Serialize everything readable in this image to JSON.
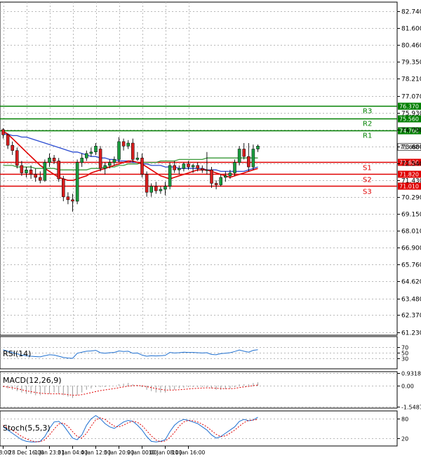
{
  "chart_data": [
    {
      "type": "candlestick",
      "title": "",
      "xlabel": "",
      "ylabel": "",
      "ylim": [
        61.02,
        83.35
      ],
      "grid": true,
      "yticks": [
        "82.740",
        "81.600",
        "80.460",
        "79.350",
        "78.210",
        "77.070",
        "75.930",
        "74.790",
        "73.680",
        "72.540",
        "71.430",
        "70.290",
        "69.150",
        "68.010",
        "66.900",
        "65.760",
        "64.620",
        "63.480",
        "62.370",
        "61.230"
      ],
      "xticks": [
        "08:00",
        "28 Dec 16:00",
        "1 Jan 23:01",
        "3 Jan 04:00",
        "4 Jan 12:00",
        "5 Jan 20:00",
        "9 Jan 00:00",
        "10 Jan 08:00",
        "11 Jan 16:00"
      ],
      "xtick_positions": [
        0,
        5,
        10,
        15,
        20,
        25,
        30,
        35,
        40
      ],
      "levels": [
        {
          "name": "R3",
          "value": 76.37,
          "label": "76.370",
          "color": "#008000"
        },
        {
          "name": "R2",
          "value": 75.56,
          "label": "75.560",
          "color": "#008000"
        },
        {
          "name": "R1",
          "value": 74.76,
          "label": "74.760",
          "color": "#008000"
        },
        {
          "name": "S1",
          "value": 72.62,
          "label": "72.620",
          "color": "#e00000"
        },
        {
          "name": "S2",
          "value": 71.82,
          "label": "71.820",
          "color": "#e00000"
        },
        {
          "name": "S3",
          "value": 71.01,
          "label": "71.010",
          "color": "#e00000"
        }
      ],
      "last_price": {
        "value": 73.68,
        "label": "73.680"
      },
      "candles": [
        [
          74.8,
          74.9,
          74.2,
          74.45
        ],
        [
          74.45,
          74.55,
          73.5,
          73.75
        ],
        [
          73.75,
          74.0,
          73.1,
          73.4
        ],
        [
          73.4,
          73.6,
          72.2,
          72.4
        ],
        [
          72.4,
          72.7,
          71.7,
          71.9
        ],
        [
          71.9,
          72.3,
          71.6,
          72.1
        ],
        [
          72.1,
          72.4,
          71.5,
          71.8
        ],
        [
          71.8,
          72.2,
          71.3,
          71.6
        ],
        [
          71.6,
          72.0,
          71.2,
          71.4
        ],
        [
          71.4,
          72.8,
          71.3,
          72.6
        ],
        [
          72.6,
          73.2,
          72.3,
          72.9
        ],
        [
          72.9,
          73.1,
          72.5,
          72.7
        ],
        [
          72.7,
          72.9,
          71.3,
          71.5
        ],
        [
          71.5,
          71.7,
          70.0,
          70.3
        ],
        [
          70.3,
          70.6,
          69.8,
          70.1
        ],
        [
          70.1,
          70.5,
          69.3,
          70.0
        ],
        [
          70.0,
          72.8,
          69.8,
          72.6
        ],
        [
          72.6,
          73.2,
          72.3,
          72.9
        ],
        [
          72.9,
          73.4,
          72.7,
          73.2
        ],
        [
          73.2,
          73.6,
          73.0,
          73.3
        ],
        [
          73.3,
          73.9,
          73.1,
          73.7
        ],
        [
          73.5,
          73.7,
          72.0,
          72.2
        ],
        [
          72.2,
          72.6,
          71.8,
          72.4
        ],
        [
          72.4,
          72.8,
          72.2,
          72.6
        ],
        [
          72.6,
          73.0,
          72.4,
          72.8
        ],
        [
          72.8,
          74.3,
          72.6,
          74.0
        ],
        [
          74.0,
          74.2,
          73.4,
          73.7
        ],
        [
          73.7,
          74.1,
          73.5,
          73.9
        ],
        [
          73.9,
          74.2,
          72.6,
          72.8
        ],
        [
          72.8,
          73.3,
          72.7,
          72.9
        ],
        [
          72.9,
          73.2,
          71.6,
          71.8
        ],
        [
          71.8,
          72.0,
          70.3,
          70.6
        ],
        [
          70.6,
          71.2,
          70.3,
          71.0
        ],
        [
          71.0,
          71.3,
          70.5,
          70.7
        ],
        [
          70.7,
          71.0,
          70.5,
          70.8
        ],
        [
          70.8,
          71.3,
          70.4,
          71.0
        ],
        [
          71.0,
          72.6,
          70.8,
          72.4
        ],
        [
          72.4,
          72.7,
          71.9,
          72.1
        ],
        [
          72.1,
          72.4,
          71.8,
          72.2
        ],
        [
          72.2,
          72.6,
          72.0,
          72.5
        ],
        [
          72.5,
          72.7,
          72.1,
          72.3
        ],
        [
          72.3,
          72.5,
          71.9,
          72.4
        ],
        [
          72.4,
          72.6,
          72.0,
          72.2
        ],
        [
          72.2,
          72.4,
          71.9,
          72.1
        ],
        [
          72.1,
          73.3,
          71.8,
          72.1
        ],
        [
          72.1,
          72.3,
          70.9,
          71.2
        ],
        [
          71.2,
          71.4,
          70.8,
          71.1
        ],
        [
          71.1,
          71.8,
          71.0,
          71.6
        ],
        [
          71.6,
          72.0,
          71.3,
          71.7
        ],
        [
          71.7,
          72.1,
          71.5,
          71.9
        ],
        [
          71.9,
          72.8,
          71.7,
          72.6
        ],
        [
          72.6,
          73.7,
          72.4,
          73.5
        ],
        [
          73.5,
          73.9,
          72.8,
          73.0
        ],
        [
          73.0,
          73.9,
          72.0,
          72.3
        ],
        [
          72.3,
          73.8,
          72.1,
          73.5
        ],
        [
          73.5,
          73.8,
          73.3,
          73.7
        ]
      ],
      "ma_blue": [
        74.5,
        74.5,
        74.4,
        74.4,
        74.3,
        74.3,
        74.2,
        74.1,
        74.0,
        73.9,
        73.8,
        73.7,
        73.6,
        73.5,
        73.4,
        73.3,
        73.3,
        73.2,
        73.1,
        73.0,
        73.0,
        72.9,
        72.9,
        72.8,
        72.8,
        72.7,
        72.7,
        72.7,
        72.6,
        72.6,
        72.5,
        72.5,
        72.4,
        72.4,
        72.4,
        72.3,
        72.3,
        72.3,
        72.2,
        72.2,
        72.2,
        72.2,
        72.2,
        72.2,
        72.1,
        72.1,
        72.1,
        72.0,
        72.0,
        72.0,
        72.0,
        72.0,
        72.0,
        72.1,
        72.2,
        72.3
      ],
      "ma_red": [
        74.7,
        74.5,
        74.2,
        73.9,
        73.6,
        73.3,
        73.0,
        72.7,
        72.4,
        72.2,
        72.0,
        71.8,
        71.6,
        71.5,
        71.4,
        71.4,
        71.5,
        71.6,
        71.7,
        71.9,
        72.0,
        72.1,
        72.2,
        72.3,
        72.4,
        72.5,
        72.6,
        72.7,
        72.7,
        72.6,
        72.5,
        72.3,
        72.1,
        71.9,
        71.7,
        71.6,
        71.5,
        71.6,
        71.7,
        71.8,
        71.9,
        72.0,
        72.1,
        72.1,
        72.1,
        72.0,
        71.9,
        71.8,
        71.7,
        71.6,
        71.7,
        71.8,
        71.9,
        72.0,
        72.1,
        72.2
      ],
      "ma_green": [
        72.4,
        72.4,
        72.4,
        72.3,
        72.3,
        72.3,
        72.3,
        72.2,
        72.2,
        72.2,
        72.2,
        72.2,
        72.1,
        72.1,
        72.1,
        72.1,
        72.1,
        72.1,
        72.1,
        72.2,
        72.2,
        72.2,
        72.3,
        72.3,
        72.3,
        72.4,
        72.4,
        72.5,
        72.5,
        72.5,
        72.6,
        72.6,
        72.6,
        72.6,
        72.7,
        72.7,
        72.7,
        72.7,
        72.8,
        72.8,
        72.8,
        72.8,
        72.8,
        72.8,
        72.9,
        72.9,
        72.9,
        72.9,
        72.9,
        72.9,
        72.9,
        72.9,
        72.9,
        72.9,
        72.9,
        72.9
      ]
    },
    {
      "type": "line",
      "title": "RSI(14)",
      "yticks": [
        "70",
        "50",
        "30"
      ],
      "ylim": [
        0,
        100
      ],
      "series": [
        {
          "color": "#1e6fd0",
          "values": [
            60,
            55,
            50,
            46,
            42,
            40,
            38,
            37,
            36,
            40,
            43,
            42,
            38,
            34,
            32,
            31,
            48,
            52,
            55,
            56,
            58,
            50,
            48,
            50,
            51,
            56,
            54,
            55,
            48,
            49,
            42,
            38,
            40,
            39,
            40,
            41,
            51,
            49,
            50,
            52,
            51,
            51,
            50,
            49,
            50,
            44,
            43,
            47,
            48,
            50,
            54,
            59,
            55,
            52,
            58,
            60
          ]
        }
      ]
    },
    {
      "type": "bar",
      "title": "MACD(12,26,9)",
      "yticks": [
        "0.9318",
        "0.00",
        "-1.5487"
      ],
      "ylim": [
        -1.5487,
        0.9318
      ],
      "values": [
        -0.1,
        -0.2,
        -0.3,
        -0.4,
        -0.5,
        -0.6,
        -0.6,
        -0.7,
        -0.7,
        -0.6,
        -0.6,
        -0.5,
        -0.6,
        -0.7,
        -0.8,
        -0.9,
        -0.7,
        -0.5,
        -0.3,
        -0.2,
        -0.1,
        -0.1,
        -0.1,
        -0.05,
        0.0,
        0.1,
        0.15,
        0.2,
        0.1,
        0.05,
        -0.1,
        -0.3,
        -0.4,
        -0.5,
        -0.5,
        -0.5,
        -0.3,
        -0.3,
        -0.2,
        -0.15,
        -0.1,
        -0.1,
        -0.1,
        -0.1,
        -0.1,
        -0.2,
        -0.3,
        -0.3,
        -0.25,
        -0.2,
        -0.1,
        0.1,
        0.1,
        0.1,
        0.2,
        0.25
      ],
      "signal": [
        -0.05,
        -0.1,
        -0.15,
        -0.22,
        -0.3,
        -0.38,
        -0.44,
        -0.5,
        -0.55,
        -0.58,
        -0.6,
        -0.6,
        -0.6,
        -0.62,
        -0.66,
        -0.7,
        -0.7,
        -0.66,
        -0.59,
        -0.51,
        -0.43,
        -0.36,
        -0.31,
        -0.26,
        -0.21,
        -0.15,
        -0.09,
        -0.03,
        0.0,
        0.01,
        -0.01,
        -0.07,
        -0.14,
        -0.21,
        -0.27,
        -0.32,
        -0.32,
        -0.32,
        -0.3,
        -0.27,
        -0.24,
        -0.21,
        -0.19,
        -0.17,
        -0.16,
        -0.17,
        -0.19,
        -0.21,
        -0.22,
        -0.22,
        -0.2,
        -0.14,
        -0.09,
        -0.05,
        0.0,
        0.05
      ]
    },
    {
      "type": "line",
      "title": "Stoch(5,5,3)",
      "yticks": [
        "80",
        "20"
      ],
      "ylim": [
        0,
        100
      ],
      "series": [
        {
          "color": "#1e6fd0",
          "values": [
            55,
            45,
            35,
            25,
            15,
            10,
            8,
            8,
            10,
            25,
            50,
            70,
            72,
            60,
            40,
            20,
            15,
            30,
            60,
            80,
            90,
            80,
            65,
            55,
            50,
            60,
            70,
            75,
            72,
            60,
            45,
            25,
            10,
            8,
            10,
            15,
            40,
            60,
            72,
            78,
            75,
            70,
            65,
            55,
            45,
            30,
            20,
            25,
            35,
            45,
            55,
            72,
            78,
            74,
            76,
            85
          ]
        },
        {
          "color": "#e00000",
          "values": [
            60,
            52,
            45,
            35,
            25,
            18,
            12,
            9,
            9,
            15,
            30,
            48,
            64,
            67,
            57,
            40,
            25,
            20,
            35,
            57,
            77,
            83,
            78,
            67,
            57,
            55,
            60,
            68,
            72,
            69,
            59,
            43,
            27,
            14,
            9,
            11,
            22,
            38,
            57,
            70,
            75,
            74,
            70,
            63,
            55,
            43,
            32,
            25,
            27,
            35,
            45,
            57,
            68,
            75,
            76,
            78
          ]
        }
      ]
    }
  ]
}
